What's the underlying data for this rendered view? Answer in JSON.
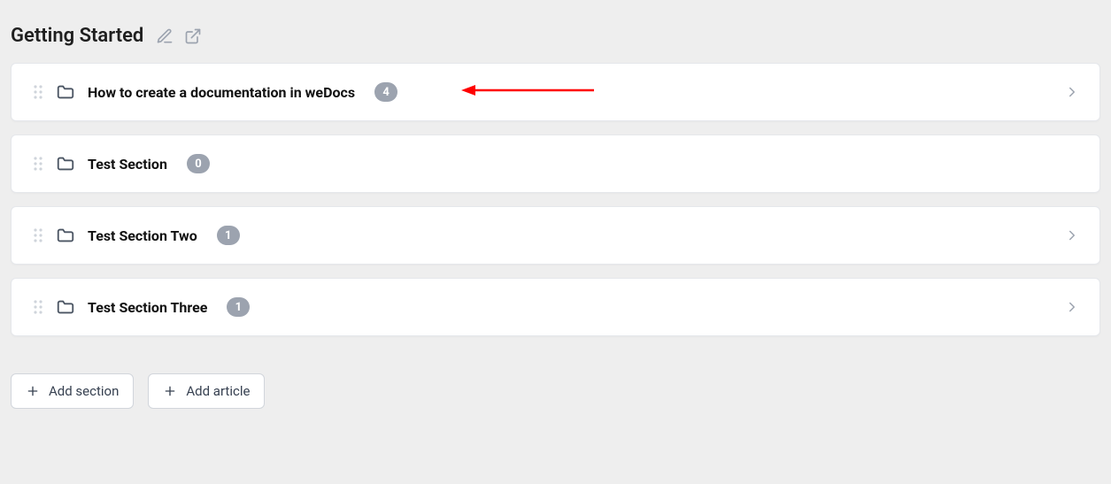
{
  "header": {
    "title": "Getting Started"
  },
  "sections": [
    {
      "label": "How to create a documentation in weDocs",
      "count": "4",
      "expandable": true,
      "annotated": true
    },
    {
      "label": "Test Section",
      "count": "0",
      "expandable": false,
      "annotated": false
    },
    {
      "label": "Test Section Two",
      "count": "1",
      "expandable": true,
      "annotated": false
    },
    {
      "label": "Test Section Three",
      "count": "1",
      "expandable": true,
      "annotated": false
    }
  ],
  "actions": {
    "add_section": "Add section",
    "add_article": "Add article"
  }
}
